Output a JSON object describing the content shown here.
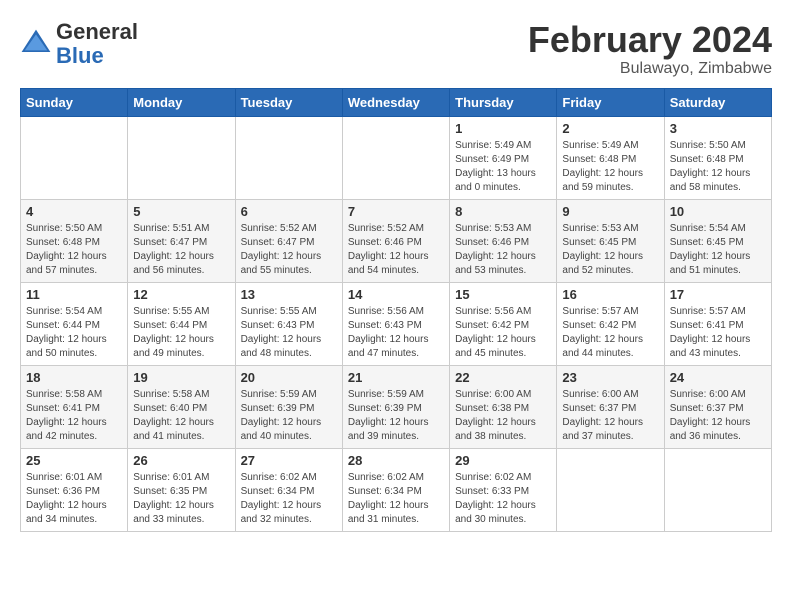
{
  "header": {
    "logo_general": "General",
    "logo_blue": "Blue",
    "month_title": "February 2024",
    "location": "Bulawayo, Zimbabwe"
  },
  "days_of_week": [
    "Sunday",
    "Monday",
    "Tuesday",
    "Wednesday",
    "Thursday",
    "Friday",
    "Saturday"
  ],
  "weeks": [
    [
      {
        "day": "",
        "info": ""
      },
      {
        "day": "",
        "info": ""
      },
      {
        "day": "",
        "info": ""
      },
      {
        "day": "",
        "info": ""
      },
      {
        "day": "1",
        "info": "Sunrise: 5:49 AM\nSunset: 6:49 PM\nDaylight: 13 hours\nand 0 minutes."
      },
      {
        "day": "2",
        "info": "Sunrise: 5:49 AM\nSunset: 6:48 PM\nDaylight: 12 hours\nand 59 minutes."
      },
      {
        "day": "3",
        "info": "Sunrise: 5:50 AM\nSunset: 6:48 PM\nDaylight: 12 hours\nand 58 minutes."
      }
    ],
    [
      {
        "day": "4",
        "info": "Sunrise: 5:50 AM\nSunset: 6:48 PM\nDaylight: 12 hours\nand 57 minutes."
      },
      {
        "day": "5",
        "info": "Sunrise: 5:51 AM\nSunset: 6:47 PM\nDaylight: 12 hours\nand 56 minutes."
      },
      {
        "day": "6",
        "info": "Sunrise: 5:52 AM\nSunset: 6:47 PM\nDaylight: 12 hours\nand 55 minutes."
      },
      {
        "day": "7",
        "info": "Sunrise: 5:52 AM\nSunset: 6:46 PM\nDaylight: 12 hours\nand 54 minutes."
      },
      {
        "day": "8",
        "info": "Sunrise: 5:53 AM\nSunset: 6:46 PM\nDaylight: 12 hours\nand 53 minutes."
      },
      {
        "day": "9",
        "info": "Sunrise: 5:53 AM\nSunset: 6:45 PM\nDaylight: 12 hours\nand 52 minutes."
      },
      {
        "day": "10",
        "info": "Sunrise: 5:54 AM\nSunset: 6:45 PM\nDaylight: 12 hours\nand 51 minutes."
      }
    ],
    [
      {
        "day": "11",
        "info": "Sunrise: 5:54 AM\nSunset: 6:44 PM\nDaylight: 12 hours\nand 50 minutes."
      },
      {
        "day": "12",
        "info": "Sunrise: 5:55 AM\nSunset: 6:44 PM\nDaylight: 12 hours\nand 49 minutes."
      },
      {
        "day": "13",
        "info": "Sunrise: 5:55 AM\nSunset: 6:43 PM\nDaylight: 12 hours\nand 48 minutes."
      },
      {
        "day": "14",
        "info": "Sunrise: 5:56 AM\nSunset: 6:43 PM\nDaylight: 12 hours\nand 47 minutes."
      },
      {
        "day": "15",
        "info": "Sunrise: 5:56 AM\nSunset: 6:42 PM\nDaylight: 12 hours\nand 45 minutes."
      },
      {
        "day": "16",
        "info": "Sunrise: 5:57 AM\nSunset: 6:42 PM\nDaylight: 12 hours\nand 44 minutes."
      },
      {
        "day": "17",
        "info": "Sunrise: 5:57 AM\nSunset: 6:41 PM\nDaylight: 12 hours\nand 43 minutes."
      }
    ],
    [
      {
        "day": "18",
        "info": "Sunrise: 5:58 AM\nSunset: 6:41 PM\nDaylight: 12 hours\nand 42 minutes."
      },
      {
        "day": "19",
        "info": "Sunrise: 5:58 AM\nSunset: 6:40 PM\nDaylight: 12 hours\nand 41 minutes."
      },
      {
        "day": "20",
        "info": "Sunrise: 5:59 AM\nSunset: 6:39 PM\nDaylight: 12 hours\nand 40 minutes."
      },
      {
        "day": "21",
        "info": "Sunrise: 5:59 AM\nSunset: 6:39 PM\nDaylight: 12 hours\nand 39 minutes."
      },
      {
        "day": "22",
        "info": "Sunrise: 6:00 AM\nSunset: 6:38 PM\nDaylight: 12 hours\nand 38 minutes."
      },
      {
        "day": "23",
        "info": "Sunrise: 6:00 AM\nSunset: 6:37 PM\nDaylight: 12 hours\nand 37 minutes."
      },
      {
        "day": "24",
        "info": "Sunrise: 6:00 AM\nSunset: 6:37 PM\nDaylight: 12 hours\nand 36 minutes."
      }
    ],
    [
      {
        "day": "25",
        "info": "Sunrise: 6:01 AM\nSunset: 6:36 PM\nDaylight: 12 hours\nand 34 minutes."
      },
      {
        "day": "26",
        "info": "Sunrise: 6:01 AM\nSunset: 6:35 PM\nDaylight: 12 hours\nand 33 minutes."
      },
      {
        "day": "27",
        "info": "Sunrise: 6:02 AM\nSunset: 6:34 PM\nDaylight: 12 hours\nand 32 minutes."
      },
      {
        "day": "28",
        "info": "Sunrise: 6:02 AM\nSunset: 6:34 PM\nDaylight: 12 hours\nand 31 minutes."
      },
      {
        "day": "29",
        "info": "Sunrise: 6:02 AM\nSunset: 6:33 PM\nDaylight: 12 hours\nand 30 minutes."
      },
      {
        "day": "",
        "info": ""
      },
      {
        "day": "",
        "info": ""
      }
    ]
  ]
}
